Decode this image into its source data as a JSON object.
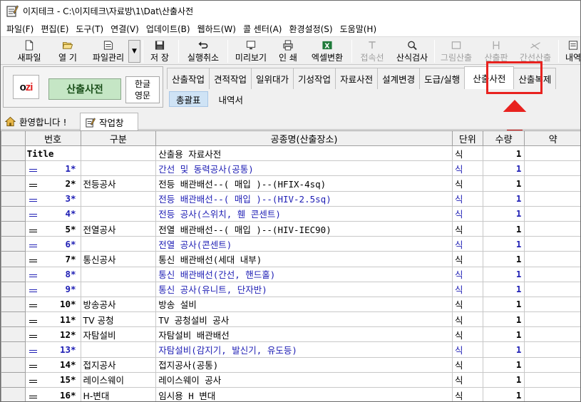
{
  "window": {
    "title": "이지테크 - C:\\이지테크\\자료방\\1\\Dat\\산출사전"
  },
  "menu": [
    "파일(F)",
    "편집(E)",
    "도구(T)",
    "연결(V)",
    "업데이트(B)",
    "웹하드(W)",
    "콜 센터(A)",
    "환경설정(S)",
    "도움말(H)"
  ],
  "toolbar": {
    "new_file": "새파일",
    "open": "열 기",
    "file_manage": "파일관리",
    "save": "저 장",
    "undo": "실행취소",
    "preview": "미리보기",
    "print": "인 쇄",
    "excel": "엑셀변환",
    "connect_line": "접속선",
    "calc_check": "산식검사",
    "draw_calc": "그림산출",
    "calc_board": "산출판",
    "trunk_calc": "간선산출",
    "detail": "내역"
  },
  "mode": {
    "logo_o": "o",
    "logo_i": "i",
    "logo_z": "zi",
    "current": "산출사전",
    "lang_ko": "한글",
    "lang_en": "영문"
  },
  "tabs": [
    "산출작업",
    "견적작업",
    "일위대가",
    "기성작업",
    "자료사전",
    "설계변경",
    "도급/실행",
    "산출사전",
    "산출복제"
  ],
  "subtabs": [
    "총괄표",
    "내역서"
  ],
  "window_tabs": {
    "welcome": "환영합니다 !",
    "work": "작업창"
  },
  "grid": {
    "headers": [
      "번호",
      "구분",
      "공종명(산출장소)",
      "단위",
      "수량",
      "약"
    ],
    "rows": [
      {
        "no": "Title",
        "cat": "",
        "name": "산출용 자료사전",
        "unit": "식",
        "qty": "1",
        "style": "title"
      },
      {
        "no": "1*",
        "cat": "",
        "name": "간선 및 동력공사(공통)",
        "unit": "식",
        "qty": "1",
        "style": "blue"
      },
      {
        "no": "2*",
        "cat": "전등공사",
        "name": "전등 배관배선--( 매입 )--(HFIX-4sq)",
        "unit": "식",
        "qty": "1",
        "style": "black"
      },
      {
        "no": "3*",
        "cat": "",
        "name": "전등 배관배선--( 매입 )--(HIV-2.5sq)",
        "unit": "식",
        "qty": "1",
        "style": "blue"
      },
      {
        "no": "4*",
        "cat": "",
        "name": "전등 공사(스위치, 휀 콘센트)",
        "unit": "식",
        "qty": "1",
        "style": "blue"
      },
      {
        "no": "5*",
        "cat": "전열공사",
        "name": "전열 배관배선--( 매입 )--(HIV-IEC90)",
        "unit": "식",
        "qty": "1",
        "style": "black"
      },
      {
        "no": "6*",
        "cat": "",
        "name": "전열 공사(콘센트)",
        "unit": "식",
        "qty": "1",
        "style": "blue"
      },
      {
        "no": "7*",
        "cat": "통신공사",
        "name": "통신 배관배선(세대 내부)",
        "unit": "식",
        "qty": "1",
        "style": "black"
      },
      {
        "no": "8*",
        "cat": "",
        "name": "통신 배관배선(간선, 핸드홀)",
        "unit": "식",
        "qty": "1",
        "style": "blue"
      },
      {
        "no": "9*",
        "cat": "",
        "name": "통신 공사(유니트, 단자반)",
        "unit": "식",
        "qty": "1",
        "style": "blue"
      },
      {
        "no": "10*",
        "cat": "방송공사",
        "name": "방송 설비",
        "unit": "식",
        "qty": "1",
        "style": "black"
      },
      {
        "no": "11*",
        "cat": "TV 공청",
        "name": "TV 공청설비 공사",
        "unit": "식",
        "qty": "1",
        "style": "black"
      },
      {
        "no": "12*",
        "cat": "자탐설비",
        "name": "자탐설비 배관배선",
        "unit": "식",
        "qty": "1",
        "style": "black"
      },
      {
        "no": "13*",
        "cat": "",
        "name": "자탐설비(감지기, 발신기, 유도등)",
        "unit": "식",
        "qty": "1",
        "style": "blue"
      },
      {
        "no": "14*",
        "cat": "접지공사",
        "name": "접지공사(공통)",
        "unit": "식",
        "qty": "1",
        "style": "black"
      },
      {
        "no": "15*",
        "cat": "레이스웨이",
        "name": "레이스웨이 공사",
        "unit": "식",
        "qty": "1",
        "style": "black"
      },
      {
        "no": "16*",
        "cat": "H-변대",
        "name": "임시용 H 변대",
        "unit": "식",
        "qty": "1",
        "style": "black"
      }
    ]
  },
  "colors": {
    "blue_text": "#1d1db4",
    "highlight": "#e8221f",
    "mode_green": "#c5e6c5",
    "subtab_blue": "#cfe3f5"
  }
}
